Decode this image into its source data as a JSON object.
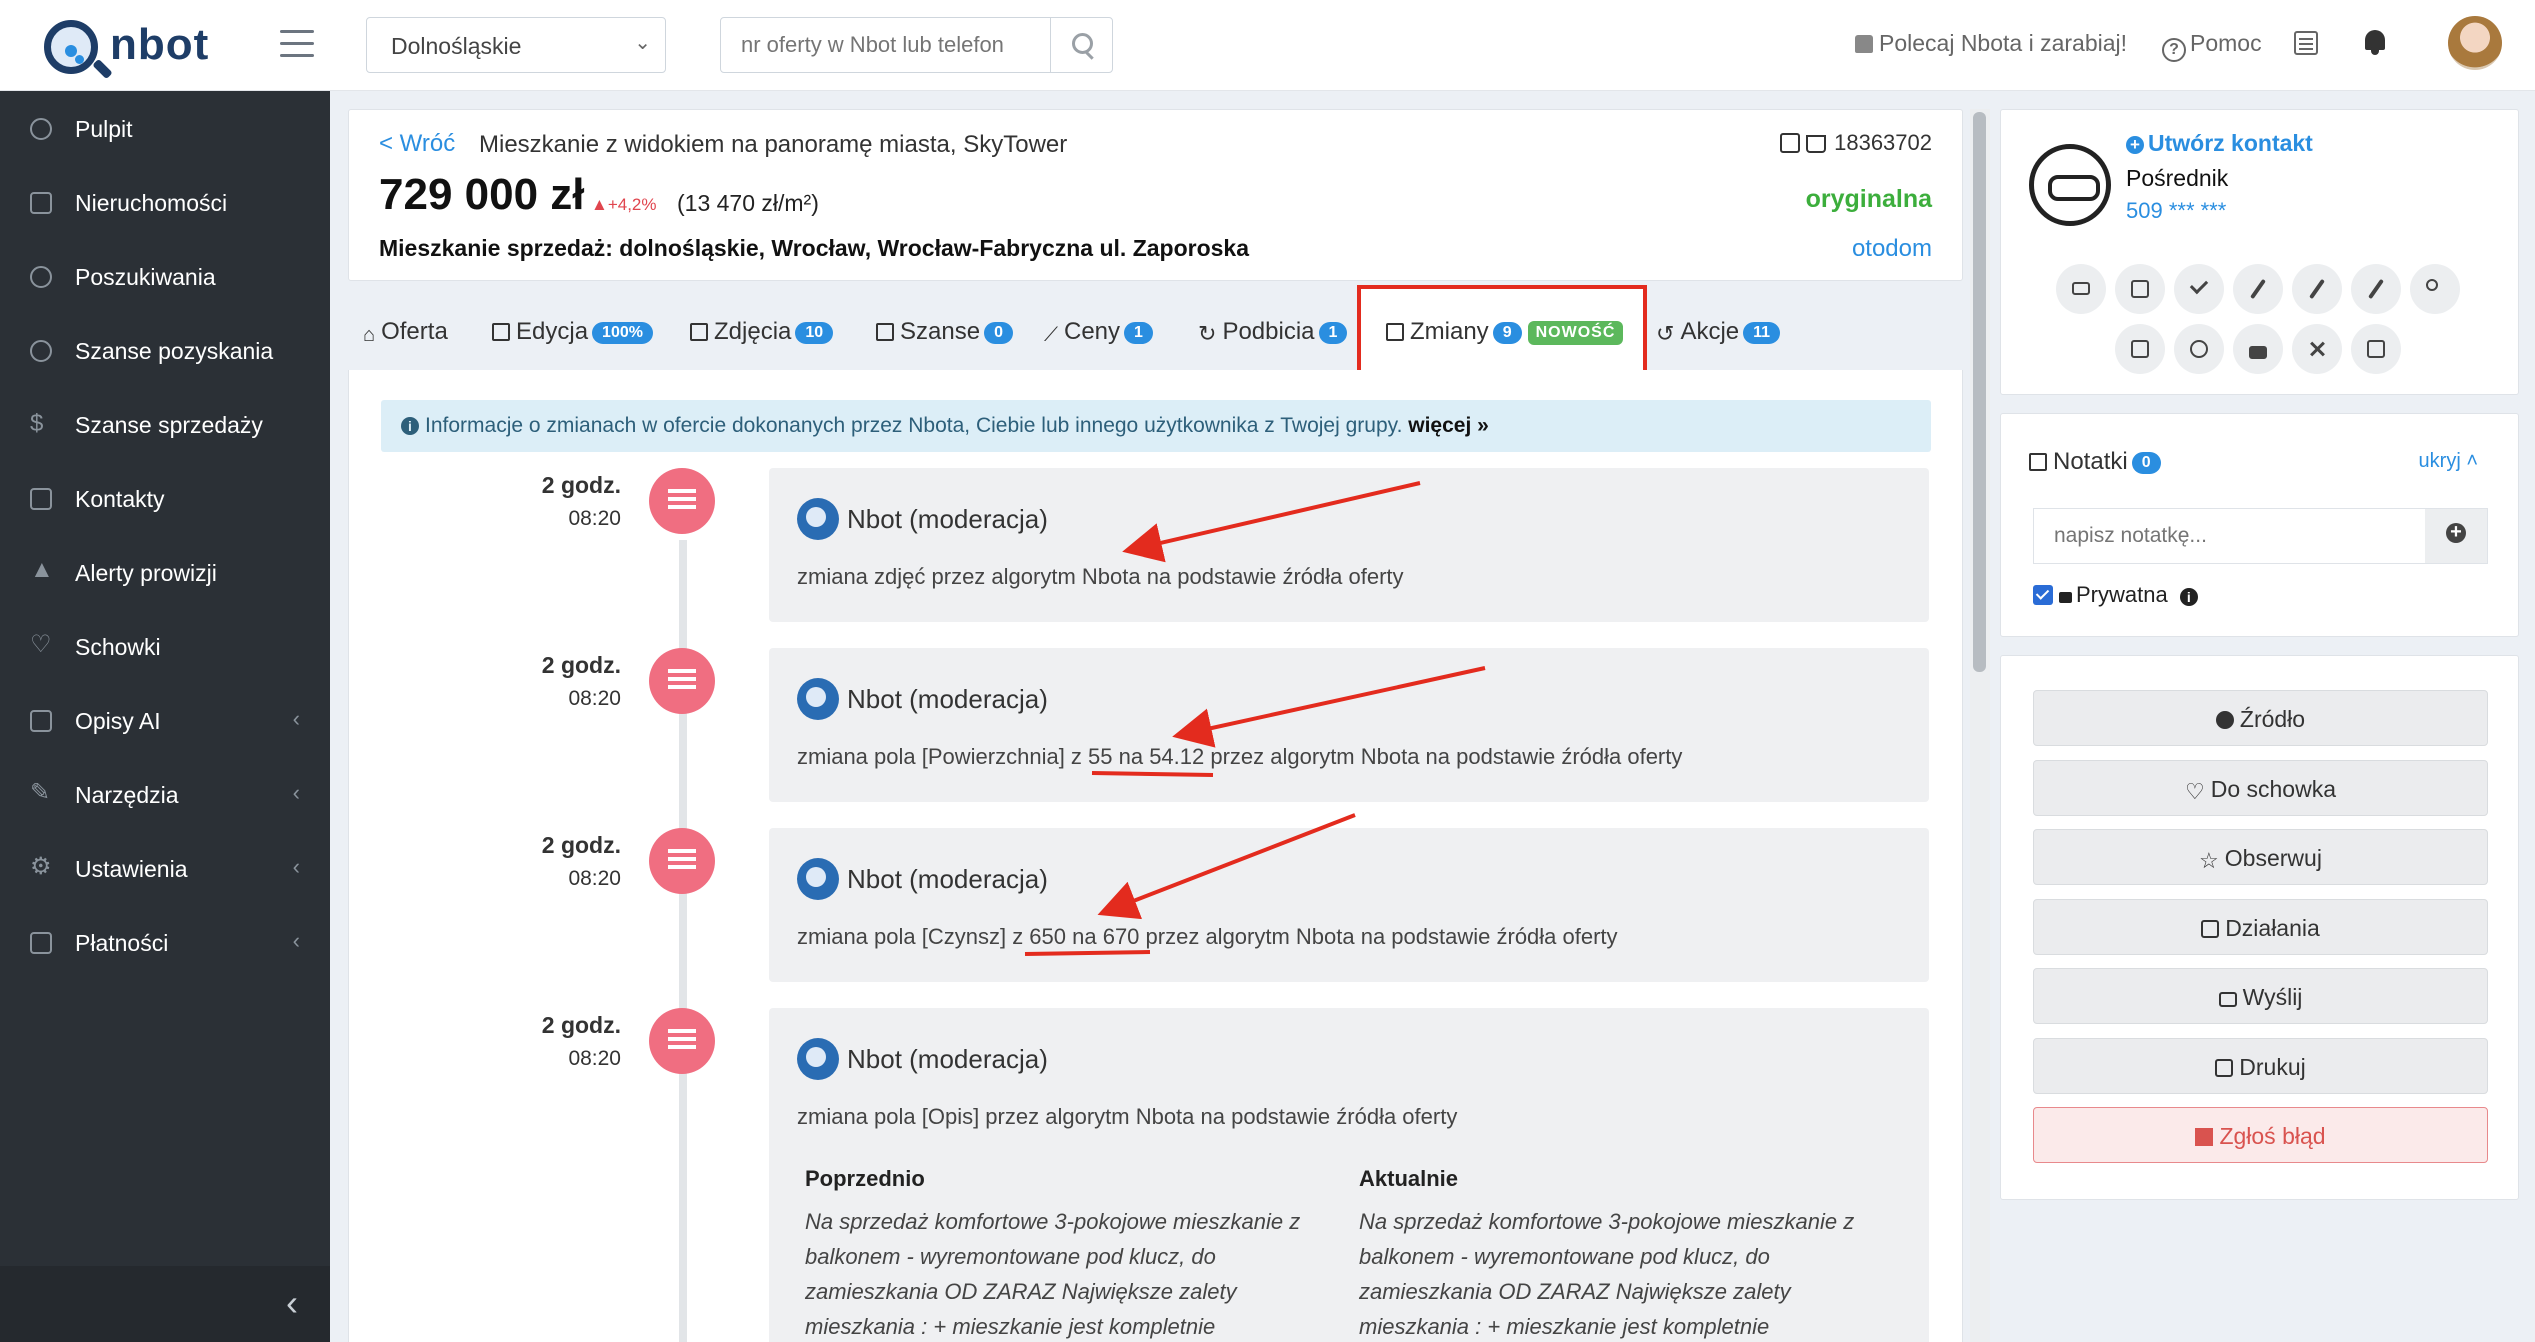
{
  "app": {
    "logo_text": "nbot"
  },
  "topbar": {
    "region": "Dolnośląskie",
    "search_placeholder": "nr oferty w Nbot lub telefon",
    "refer": "Polecaj Nbota i zarabiaj!",
    "help": "Pomoc"
  },
  "sidebar": {
    "items": [
      {
        "label": "Pulpit",
        "icon": "dashboard-icon"
      },
      {
        "label": "Nieruchomości",
        "icon": "home-icon"
      },
      {
        "label": "Poszukiwania",
        "icon": "bell-icon"
      },
      {
        "label": "Szanse pozyskania",
        "icon": "handshake-icon"
      },
      {
        "label": "Szanse sprzedaży",
        "icon": "dollar-icon"
      },
      {
        "label": "Kontakty",
        "icon": "contact-card-icon"
      },
      {
        "label": "Alerty prowizji",
        "icon": "warning-icon"
      },
      {
        "label": "Schowki",
        "icon": "heart-icon"
      },
      {
        "label": "Opisy AI",
        "icon": "comment-icon"
      },
      {
        "label": "Narzędzia",
        "icon": "wrench-icon"
      },
      {
        "label": "Ustawienia",
        "icon": "gear-icon"
      },
      {
        "label": "Płatności",
        "icon": "cart-icon"
      }
    ]
  },
  "listing": {
    "back": "< Wróć",
    "title": "Mieszkanie z widokiem na panoramę miasta, SkyTower",
    "id": "18363702",
    "price": "729 000 zł",
    "price_change": "▲+4,2%",
    "price_per_m2": "(13 470 zł/m²)",
    "status": "oryginalna",
    "address": "Mieszkanie sprzedaż: dolnośląskie, Wrocław, Wrocław-Fabryczna ul. Zaporoska",
    "source": "otodom"
  },
  "tabs": [
    {
      "label": "Oferta",
      "badge": ""
    },
    {
      "label": "Edycja",
      "badge": "100%"
    },
    {
      "label": "Zdjęcia",
      "badge": "10"
    },
    {
      "label": "Szanse",
      "badge": "0"
    },
    {
      "label": "Ceny",
      "badge": "1"
    },
    {
      "label": "Podbicia",
      "badge": "1"
    },
    {
      "label": "Zmiany",
      "badge": "9",
      "new_badge": "NOWOŚĆ"
    },
    {
      "label": "Akcje",
      "badge": "11"
    }
  ],
  "info_bar": {
    "text": "Informacje o zmianach w ofercie dokonanych przez Nbota, Ciebie lub innego użytkownika z Twojej grupy.",
    "more": "więcej »"
  },
  "changes": [
    {
      "relative": "2 godz.",
      "time": "08:20",
      "author": "Nbot (moderacja)",
      "text": "zmiana zdjęć przez algorytm Nbota na podstawie źródła oferty"
    },
    {
      "relative": "2 godz.",
      "time": "08:20",
      "author": "Nbot (moderacja)",
      "text": "zmiana pola [Powierzchnia] z 55 na 54.12 przez algorytm Nbota na podstawie źródła oferty"
    },
    {
      "relative": "2 godz.",
      "time": "08:20",
      "author": "Nbot (moderacja)",
      "text": "zmiana pola [Czynsz] z 650 na 670 przez algorytm Nbota na podstawie źródła oferty"
    },
    {
      "relative": "2 godz.",
      "time": "08:20",
      "author": "Nbot (moderacja)",
      "text": "zmiana pola [Opis] przez algorytm Nbota na podstawie źródła oferty",
      "previous_label": "Poprzednio",
      "current_label": "Aktualnie",
      "previous": "Na sprzedaż komfortowe 3-pokojowe mieszkanie z balkonem - wyremontowane pod klucz, do zamieszkania OD ZARAZ Największe zalety mieszkania : + mieszkanie jest kompletnie",
      "current": "Na sprzedaż komfortowe 3-pokojowe mieszkanie z balkonem - wyremontowane pod klucz, do zamieszkania OD ZARAZ Największe zalety mieszkania : + mieszkanie jest kompletnie"
    }
  ],
  "contact": {
    "create": "Utwórz kontakt",
    "role": "Pośrednik",
    "phone": "509 *** ***"
  },
  "notes": {
    "title": "Notatki",
    "count": "0",
    "hide": "ukryj ˄",
    "placeholder": "napisz notatkę...",
    "private": "Prywatna"
  },
  "actions": {
    "source": "Źródło",
    "favorite": "Do schowka",
    "watch": "Obserwuj",
    "activities": "Działania",
    "send": "Wyślij",
    "print": "Drukuj",
    "report": "Zgłoś błąd"
  },
  "colors": {
    "accent": "#2a8ee0",
    "sidebar": "#2b3036",
    "timeline_dot": "#f06e81",
    "status_green": "#3cae3c",
    "annotation_red": "#e32b1e"
  }
}
